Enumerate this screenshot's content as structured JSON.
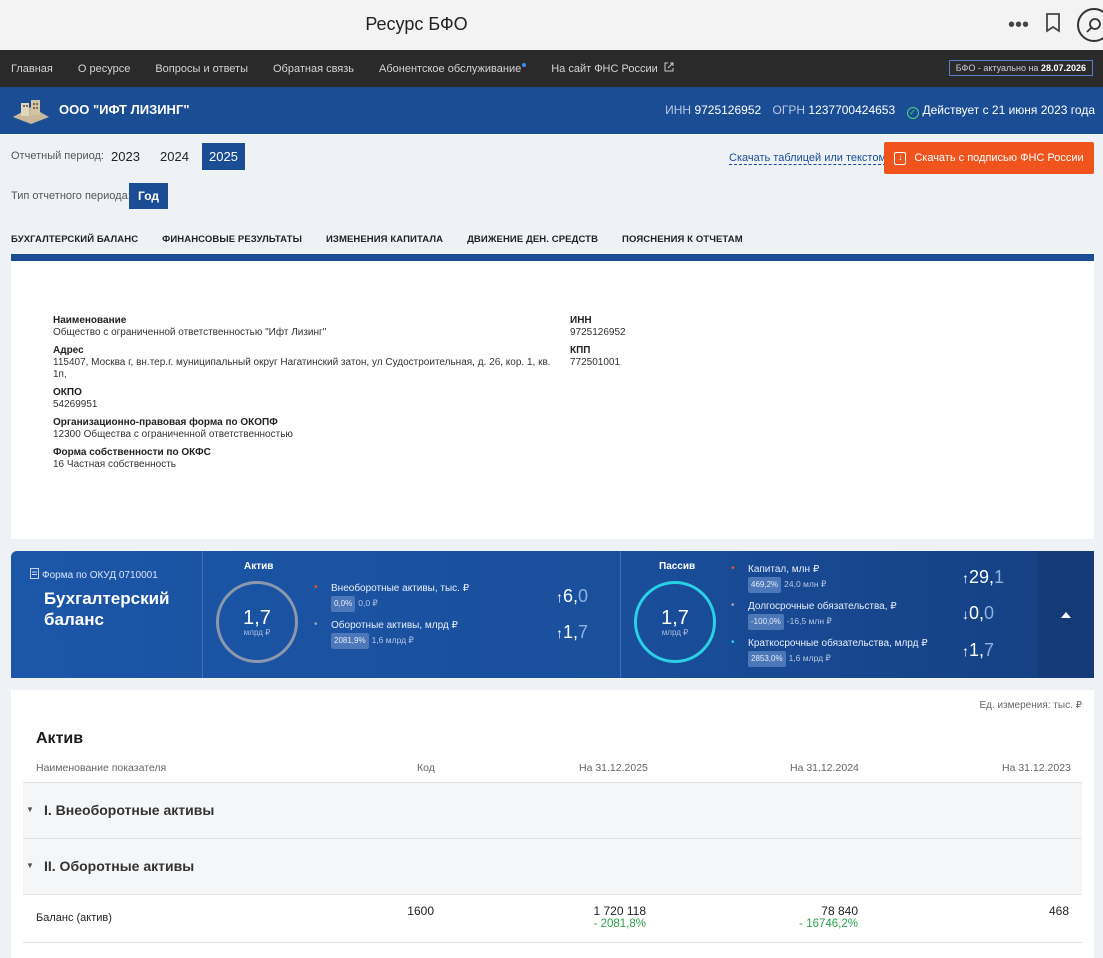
{
  "browser": {
    "title": "Ресурс БФО",
    "more_icon": "more-icon",
    "bookmark_icon": "bookmark-icon",
    "search_icon": "search-icon"
  },
  "topnav": {
    "items": [
      "Главная",
      "О ресурсе",
      "Вопросы и ответы",
      "Обратная связь",
      "Абонентское обслуживание",
      "На сайт ФНС России"
    ],
    "freshness_label": "БФО - актуально на",
    "freshness_date": "28.07.2026"
  },
  "company": {
    "name": "ООО \"ИФТ ЛИЗИНГ\"",
    "inn_label": "ИНН",
    "inn": "9725126952",
    "ogrn_label": "ОГРН",
    "ogrn": "1237700424653",
    "status": "Действует с 21 июня 2023 года"
  },
  "period": {
    "label": "Отчетный период:",
    "years": [
      "2023",
      "2024",
      "2025"
    ],
    "active_year": "2025",
    "type_label": "Тип отчетного периода:",
    "type_value": "Год",
    "download_link": "Скачать таблицей или текстом",
    "download_button": "Скачать с подписью ФНС России"
  },
  "tabs": [
    "БУХГАЛТЕРСКИЙ БАЛАНС",
    "ФИНАНСОВЫЕ РЕЗУЛЬТАТЫ",
    "ИЗМЕНЕНИЯ КАПИТАЛА",
    "ДВИЖЕНИЕ ДЕН. СРЕДСТВ",
    "ПОЯСНЕНИЯ К ОТЧЕТАМ"
  ],
  "org_info": {
    "name_label": "Наименование",
    "name_value": "Общество с ограниченной ответственностью \"Ифт Лизинг\"",
    "address_label": "Адрес",
    "address_value": "115407, Москва г, вн.тер.г. муниципальный округ Нагатинский затон, ул Судостроительная, д. 26, кор. 1, кв. 1п,",
    "okpo_label": "ОКПО",
    "okpo_value": "54269951",
    "okopf_label": "Организационно-правовая форма по ОКОПФ",
    "okopf_value": "12300 Общества с ограниченной ответственностью",
    "okfs_label": "Форма собственности по ОКФС",
    "okfs_value": "16 Частная собственность",
    "inn_label": "ИНН",
    "inn_value": "9725126952",
    "kpp_label": "КПП",
    "kpp_value": "772501001"
  },
  "summary": {
    "form_label": "Форма по ОКУД 0710001",
    "title": "Бухгалтерский баланс",
    "aktiv": {
      "label": "Актив",
      "total": "1,7",
      "unit": "млрд ₽",
      "items": [
        {
          "name": "Внеоборотные активы, тыс. ₽",
          "badge": "0,0%",
          "sub": "0,0 ₽",
          "trend_int": "6,",
          "trend_dec": "0",
          "arrow": "↑",
          "dot_color": "#f0541c"
        },
        {
          "name": "Оборотные активы, млрд ₽",
          "badge": "2081,9%",
          "sub": "1,6 млрд ₽",
          "trend_int": "1,",
          "trend_dec": "7",
          "arrow": "↑",
          "dot_color": "#9aa6b8"
        }
      ]
    },
    "passiv": {
      "label": "Пассив",
      "total": "1,7",
      "unit": "млрд ₽",
      "items": [
        {
          "name": "Капитал, млн ₽",
          "badge": "469,2%",
          "sub": "24,0 млн ₽",
          "trend_int": "29,",
          "trend_dec": "1",
          "arrow": "↑",
          "dot_color": "#f0541c"
        },
        {
          "name": "Долгосрочные обязательства, ₽",
          "badge": "-100,0%",
          "sub": "-16,5 млн ₽",
          "trend_int": "0,",
          "trend_dec": "0",
          "arrow": "↓",
          "dot_color": "#9aa6b8"
        },
        {
          "name": "Краткосрочные обязательства, млрд ₽",
          "badge": "2853,0%",
          "sub": "1,6 млрд ₽",
          "trend_int": "1,",
          "trend_dec": "7",
          "arrow": "↑",
          "dot_color": "#2ad0e6"
        }
      ]
    }
  },
  "table": {
    "units": "Ед. измерения: тыс. ₽",
    "title": "Актив",
    "headers": [
      "Наименование показателя",
      "Код",
      "На 31.12.2025",
      "На 31.12.2024",
      "На 31.12.2023"
    ],
    "sections": [
      "I. Внеоборотные активы",
      "II. Оборотные активы"
    ],
    "rows": [
      {
        "name": "Баланс (актив)",
        "code": "1600",
        "v2025": "1 720 118",
        "p2025": "- 2081,8%",
        "v2024": "78 840",
        "p2024": "- 16746,2%",
        "v2023": "468"
      }
    ]
  }
}
